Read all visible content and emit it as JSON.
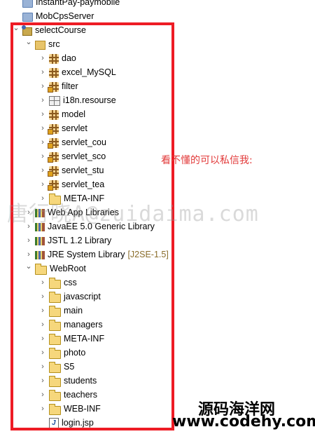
{
  "tree": [
    {
      "label": "InstantPay-paymobile",
      "icon": "project-icon",
      "depth": 0,
      "tw": ""
    },
    {
      "label": "MobCpsServer",
      "icon": "project-icon",
      "depth": 0,
      "tw": ""
    },
    {
      "label": "selectCourse",
      "icon": "java-project-icon",
      "depth": 0,
      "tw": "v"
    },
    {
      "label": "src",
      "icon": "source-folder-icon",
      "depth": 1,
      "tw": "v"
    },
    {
      "label": "dao",
      "icon": "package-icon",
      "depth": 2,
      "tw": ">"
    },
    {
      "label": "excel_MySQL",
      "icon": "package-icon",
      "depth": 2,
      "tw": ">"
    },
    {
      "label": "filter",
      "icon": "java-package-icon",
      "depth": 2,
      "tw": ">"
    },
    {
      "label": "i18n.resourse",
      "icon": "resource-package-icon",
      "depth": 2,
      "tw": ">"
    },
    {
      "label": "model",
      "icon": "package-icon",
      "depth": 2,
      "tw": ">"
    },
    {
      "label": "servlet",
      "icon": "java-package-icon",
      "depth": 2,
      "tw": ">"
    },
    {
      "label": "servlet_cou",
      "icon": "java-package-icon",
      "depth": 2,
      "tw": ">"
    },
    {
      "label": "servlet_sco",
      "icon": "java-package-icon",
      "depth": 2,
      "tw": ">"
    },
    {
      "label": "servlet_stu",
      "icon": "java-package-icon",
      "depth": 2,
      "tw": ">"
    },
    {
      "label": "servlet_tea",
      "icon": "java-package-icon",
      "depth": 2,
      "tw": ">"
    },
    {
      "label": "META-INF",
      "icon": "folder-icon",
      "depth": 2,
      "tw": ">"
    },
    {
      "label": "Web App Libraries",
      "icon": "library-icon",
      "depth": 1,
      "tw": ">"
    },
    {
      "label": "JavaEE 5.0 Generic Library",
      "icon": "library-icon",
      "depth": 1,
      "tw": ">"
    },
    {
      "label": "JSTL 1.2 Library",
      "icon": "library-icon",
      "depth": 1,
      "tw": ">"
    },
    {
      "label": "JRE System Library",
      "icon": "library-icon",
      "depth": 1,
      "tw": ">",
      "decoration": "[J2SE-1.5]"
    },
    {
      "label": "WebRoot",
      "icon": "folder-icon",
      "depth": 1,
      "tw": "v"
    },
    {
      "label": "css",
      "icon": "folder-icon",
      "depth": 2,
      "tw": ">"
    },
    {
      "label": "javascript",
      "icon": "folder-icon",
      "depth": 2,
      "tw": ">"
    },
    {
      "label": "main",
      "icon": "folder-icon",
      "depth": 2,
      "tw": ">"
    },
    {
      "label": "managers",
      "icon": "folder-icon",
      "depth": 2,
      "tw": ">"
    },
    {
      "label": "META-INF",
      "icon": "folder-icon",
      "depth": 2,
      "tw": ">"
    },
    {
      "label": "photo",
      "icon": "folder-icon",
      "depth": 2,
      "tw": ">"
    },
    {
      "label": "S5",
      "icon": "folder-icon",
      "depth": 2,
      "tw": ">"
    },
    {
      "label": "students",
      "icon": "folder-icon",
      "depth": 2,
      "tw": ">"
    },
    {
      "label": "teachers",
      "icon": "folder-icon",
      "depth": 2,
      "tw": ">"
    },
    {
      "label": "WEB-INF",
      "icon": "folder-icon",
      "depth": 2,
      "tw": ">"
    },
    {
      "label": "login.jsp",
      "icon": "jsp-file-icon",
      "depth": 2,
      "tw": ""
    }
  ],
  "annotation_note": "看不懂的可以私信我:",
  "watermark": "唐行晓A@zuidaima.com",
  "site_name": "源码海洋网",
  "site_url": "www.codehy.com",
  "colors": {
    "highlight_box": "#ee1c25",
    "note": "#e23a3a"
  }
}
